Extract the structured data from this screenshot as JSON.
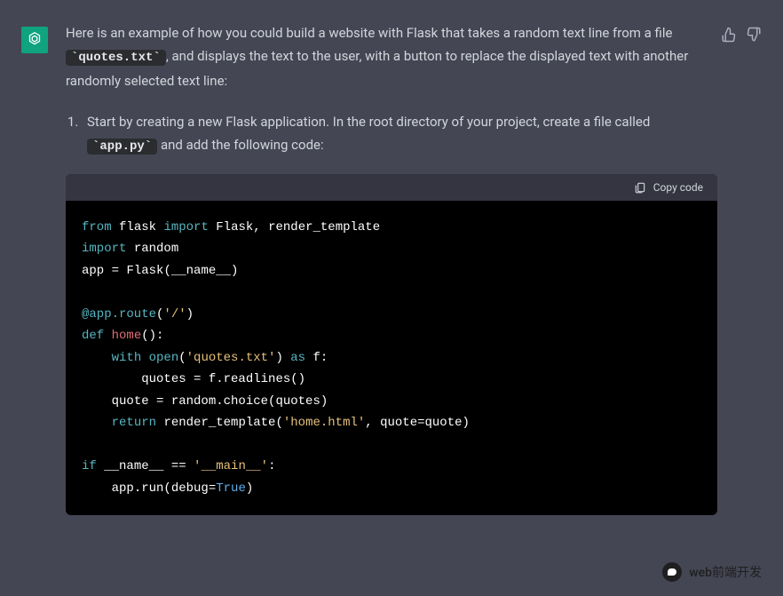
{
  "message": {
    "intro_part1": "Here is an example of how you could build a website with Flask that takes a random text line from a file ",
    "intro_code1": "`quotes.txt`",
    "intro_part2": ", and displays the text to the user, with a button to replace the displayed text with another randomly selected text line:",
    "step1_part1": "Start by creating a new Flask application. In the root directory of your project, create a file called ",
    "step1_code1": "`app.py`",
    "step1_part2": " and add the following code:"
  },
  "code": {
    "copy_label": "Copy code",
    "tokens": {
      "from": "from",
      "flask": "flask",
      "import": "import",
      "flask_cls": "Flask",
      "render_template": "render_template",
      "random": "random",
      "app": "app",
      "eq": " = ",
      "flask_call": "Flask(__name__)",
      "decorator": "@app.route",
      "route_str": "'/'",
      "def": "def",
      "home": "home",
      "with": "with",
      "open": "open",
      "quotes_txt": "'quotes.txt'",
      "as": "as",
      "f": "f:",
      "quotes_assign": "quotes = f.readlines()",
      "quote_assign": "quote = random.choice(quotes)",
      "return": "return",
      "render_call": "render_template(",
      "home_html": "'home.html'",
      "quote_kwarg": ", quote=quote)",
      "if": "if",
      "name": "__name__",
      "eqeq": " == ",
      "main": "'__main__'",
      "run": "app.run(debug=",
      "true": "True",
      "close": ")"
    }
  },
  "footer": {
    "label": "web前端开发"
  }
}
